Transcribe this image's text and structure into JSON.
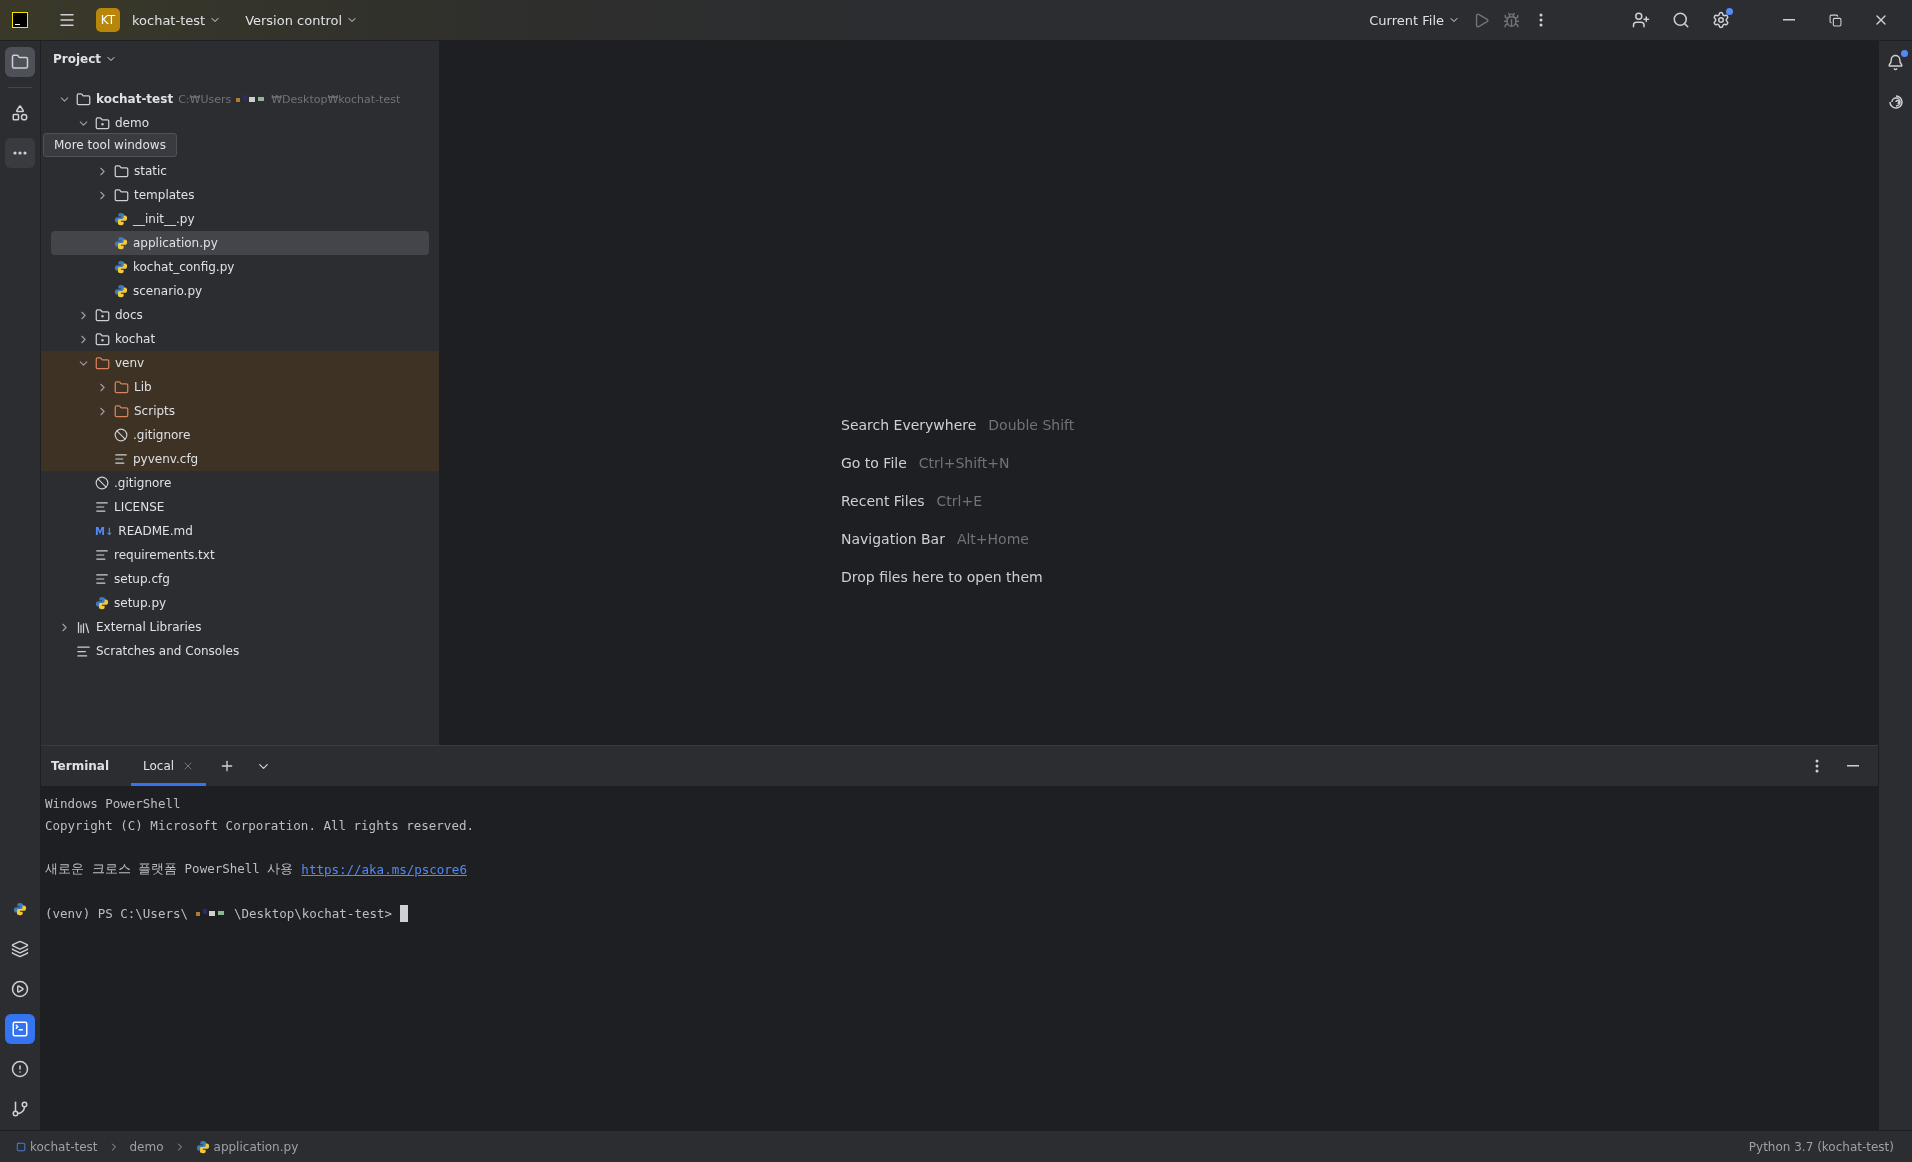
{
  "titlebar": {
    "project_badge": "KT",
    "project": "kochat-test",
    "vcs": "Version control",
    "run_config": "Current File",
    "settings_badge": true
  },
  "left_tools_top": [
    {
      "kind": "folder",
      "selected": true
    },
    {
      "kind": "structure",
      "selected": false
    },
    {
      "kind": "more",
      "selected": false,
      "hovered": true
    }
  ],
  "left_tools_bottom": [
    {
      "kind": "python",
      "selected": false
    },
    {
      "kind": "layers",
      "selected": false
    },
    {
      "kind": "services",
      "selected": false
    },
    {
      "kind": "terminal",
      "selected": true
    },
    {
      "kind": "problems",
      "selected": false
    },
    {
      "kind": "git",
      "selected": false
    }
  ],
  "project_panel": {
    "title": "Project",
    "tree": [
      {
        "kind": "root",
        "label": "kochat-test",
        "path_start": "C:₩Users",
        "path_end": "₩Desktop₩kochat-test",
        "expanded": true,
        "children": [
          {
            "kind": "module",
            "label": "demo",
            "expanded": true,
            "tooltip": "More tool windows",
            "children": [
              {
                "kind": "folder",
                "label": "static",
                "expanded": false
              },
              {
                "kind": "folder",
                "label": "templates",
                "expanded": false
              },
              {
                "kind": "python",
                "label": "__init__.py",
                "selected": false
              },
              {
                "kind": "python",
                "label": "application.py",
                "selected": true
              },
              {
                "kind": "python",
                "label": "kochat_config.py",
                "selected": false
              },
              {
                "kind": "python",
                "label": "scenario.py",
                "selected": false
              }
            ]
          },
          {
            "kind": "module",
            "label": "docs",
            "expanded": false
          },
          {
            "kind": "module",
            "label": "kochat",
            "expanded": false
          },
          {
            "kind": "folder",
            "label": "venv",
            "expanded": true,
            "excluded": true,
            "children": [
              {
                "kind": "folder",
                "label": "Lib",
                "expanded": false,
                "excluded": true
              },
              {
                "kind": "folder",
                "label": "Scripts",
                "expanded": false,
                "excluded": true
              },
              {
                "kind": "ignore",
                "label": ".gitignore",
                "selected": false
              },
              {
                "kind": "text",
                "label": "pyvenv.cfg",
                "selected": false
              }
            ]
          },
          {
            "kind": "ignore",
            "label": ".gitignore",
            "selected": false
          },
          {
            "kind": "text",
            "label": "LICENSE",
            "selected": false
          },
          {
            "kind": "markdown",
            "badge": "M↓",
            "label": "README.md",
            "selected": false
          },
          {
            "kind": "text",
            "label": "requirements.txt",
            "selected": false
          },
          {
            "kind": "text",
            "label": "setup.cfg",
            "selected": false
          },
          {
            "kind": "python",
            "label": "setup.py",
            "selected": false
          }
        ]
      },
      {
        "kind": "libraries",
        "label": "External Libraries",
        "expanded": false
      },
      {
        "kind": "scratches",
        "label": "Scratches and Consoles"
      }
    ]
  },
  "editor_hints": [
    {
      "action": "Search Everywhere",
      "shortcut": "Double Shift"
    },
    {
      "action": "Go to File",
      "shortcut": "Ctrl+Shift+N"
    },
    {
      "action": "Recent Files",
      "shortcut": "Ctrl+E"
    },
    {
      "action": "Navigation Bar",
      "shortcut": "Alt+Home"
    },
    {
      "action": "Drop files here to open them"
    }
  ],
  "terminal": {
    "title": "Terminal",
    "tabs": [
      {
        "label": "Local",
        "selected": true
      }
    ],
    "blocks": [
      [
        {
          "segments": [
            {
              "kind": "text",
              "text": "Windows PowerShell"
            }
          ]
        },
        {
          "segments": [
            {
              "kind": "text",
              "text": "Copyright (C) Microsoft Corporation. All rights reserved."
            }
          ]
        }
      ],
      [
        {
          "segments": [
            {
              "kind": "text",
              "text": "새로운 크로스 플랫폼 PowerShell 사용"
            },
            {
              "kind": "link",
              "text": "https://aka.ms/pscore6"
            }
          ]
        }
      ],
      [
        {
          "segments": [
            {
              "kind": "text",
              "text": "(venv) PS C:\\Users\\"
            },
            {
              "kind": "redacted"
            },
            {
              "kind": "text",
              "text": "\\Desktop\\kochat-test>"
            },
            {
              "kind": "cursor"
            }
          ]
        }
      ]
    ]
  },
  "status_bar": {
    "breadcrumbs": [
      {
        "kind": "module",
        "label": "kochat-test"
      },
      {
        "kind": "folder",
        "label": "demo"
      },
      {
        "kind": "python",
        "label": "application.py"
      }
    ],
    "interpreter": "Python 3.7 (kochat-test)"
  }
}
